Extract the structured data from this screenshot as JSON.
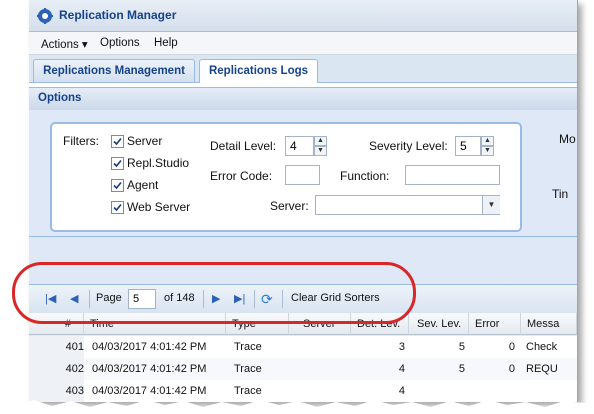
{
  "app": {
    "title": "Replication Manager"
  },
  "menu": {
    "items": [
      "Actions ▾",
      "Options",
      "Help"
    ]
  },
  "tabs": [
    {
      "label": "Replications Management",
      "active": false
    },
    {
      "label": "Replications Logs",
      "active": true
    }
  ],
  "options": {
    "title": "Options",
    "filters_label": "Filters:",
    "checkboxes": [
      {
        "label": "Server",
        "checked": true
      },
      {
        "label": "Repl.Studio",
        "checked": true
      },
      {
        "label": "Agent",
        "checked": true
      },
      {
        "label": "Web Server",
        "checked": true
      }
    ],
    "detail_level": {
      "label": "Detail Level:",
      "value": "4"
    },
    "severity_level": {
      "label": "Severity Level:",
      "value": "5"
    },
    "error_code": {
      "label": "Error Code:",
      "value": ""
    },
    "function": {
      "label": "Function:",
      "value": ""
    },
    "server": {
      "label": "Server:",
      "value": ""
    },
    "side_labels": [
      "Mo",
      "Tin"
    ]
  },
  "toolbar": {
    "page_label": "Page",
    "page_value": "5",
    "of_label": "of 148",
    "clear_label": "Clear Grid Sorters"
  },
  "grid": {
    "columns": [
      "#",
      "Time",
      "Type",
      "Server",
      "Det. Lev.",
      "Sev. Lev.",
      "Error",
      "Messa"
    ],
    "rows": [
      {
        "num": "401",
        "time": "04/03/2017 4:01:42 PM",
        "type": "Trace",
        "server": "",
        "det": "3",
        "sev": "5",
        "error": "0",
        "msg": "Check"
      },
      {
        "num": "402",
        "time": "04/03/2017 4:01:42 PM",
        "type": "Trace",
        "server": "",
        "det": "4",
        "sev": "5",
        "error": "0",
        "msg": "REQU"
      },
      {
        "num": "403",
        "time": "04/03/2017 4:01:42 PM",
        "type": "Trace",
        "server": "",
        "det": "4",
        "sev": "",
        "error": "",
        "msg": ""
      }
    ]
  },
  "colors": {
    "accent": "#15428b",
    "highlight": "#d92626",
    "panel": "#dfe8f6"
  }
}
